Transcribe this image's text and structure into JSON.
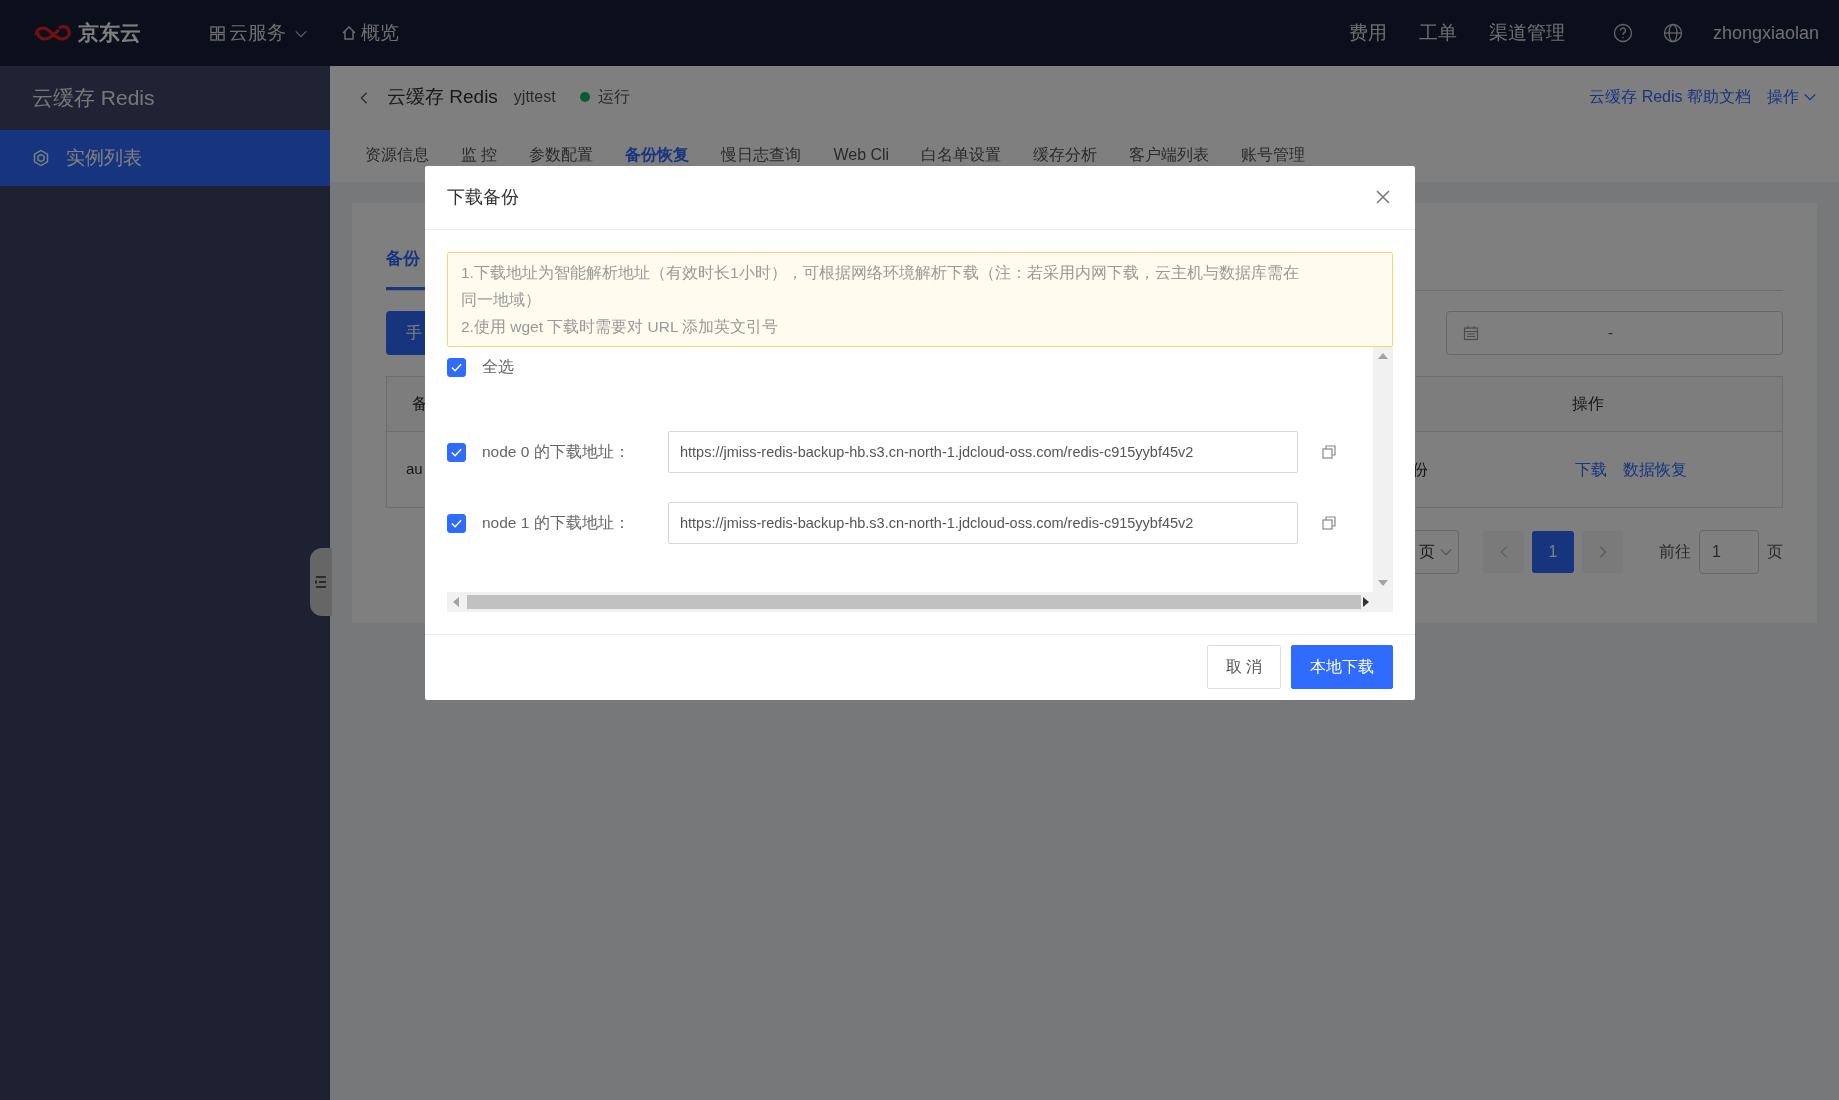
{
  "topbar": {
    "logo": "京东云",
    "nav": [
      {
        "label": "云服务",
        "kind": "dropdown"
      },
      {
        "label": "概览",
        "kind": "home"
      }
    ],
    "links": [
      "费用",
      "工单",
      "渠道管理"
    ],
    "user": "zhongxiaolan"
  },
  "sidebar": {
    "title": "云缓存 Redis",
    "items": [
      {
        "label": "实例列表",
        "selected": true
      }
    ]
  },
  "header": {
    "title": "云缓存 Redis",
    "instance": "yjttest",
    "status": "运行",
    "help_link": "云缓存 Redis 帮助文档",
    "actions": "操作"
  },
  "tabs": [
    {
      "label": "资源信息",
      "selected": false
    },
    {
      "label": "监 控",
      "selected": false
    },
    {
      "label": "参数配置",
      "selected": false
    },
    {
      "label": "备份恢复",
      "selected": true
    },
    {
      "label": "慢日志查询",
      "selected": false
    },
    {
      "label": "Web Cli",
      "selected": false
    },
    {
      "label": "白名单设置",
      "selected": false
    },
    {
      "label": "缓存分析",
      "selected": false
    },
    {
      "label": "客户端列表",
      "selected": false
    },
    {
      "label": "账号管理",
      "selected": false
    }
  ],
  "content": {
    "subtab": "备份",
    "button": "手",
    "date_separator": "-",
    "table": {
      "columns": [
        "备",
        "操作"
      ],
      "rows": [
        {
          "cells": [
            "au",
            "份"
          ],
          "actions": [
            "下载",
            "数据恢复"
          ]
        }
      ]
    },
    "pagination": {
      "size_select": "页",
      "pages": [
        {
          "label": "1",
          "selected": true
        }
      ],
      "goto_label": "前往",
      "goto_value": "1",
      "page_suffix": "页"
    }
  },
  "dialog": {
    "title": "下载备份",
    "notes": [
      "1.下载地址为智能解析地址（有效时长1小时），可根据网络环境解析下载（注：若采用内网下载，云主机与数据库需在同一地域）",
      "2.使用 wget 下载时需要对 URL 添加英文引号"
    ],
    "select_all": {
      "label": "全选",
      "checked": true
    },
    "nodes": [
      {
        "label": "node 0 的下载地址：",
        "url": "https://jmiss-redis-backup-hb.s3.cn-north-1.jdcloud-oss.com/redis-c915yybf45v2",
        "checked": true
      },
      {
        "label": "node 1 的下载地址：",
        "url": "https://jmiss-redis-backup-hb.s3.cn-north-1.jdcloud-oss.com/redis-c915yybf45v2",
        "checked": true
      }
    ],
    "buttons": [
      {
        "label": "取 消",
        "kind": "secondary"
      },
      {
        "label": "本地下载",
        "kind": "primary"
      }
    ]
  }
}
